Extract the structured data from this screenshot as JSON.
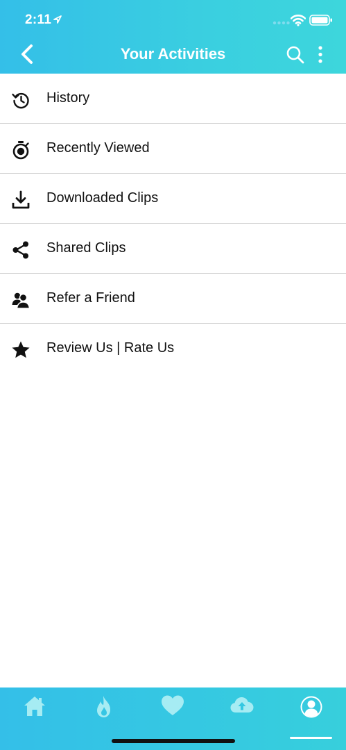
{
  "status_bar": {
    "time": "2:11"
  },
  "navbar": {
    "title": "Your Activities",
    "icons": [
      "back-chevron-icon",
      "search-icon",
      "more-vertical-icon"
    ]
  },
  "menu": {
    "items": [
      {
        "label": "History",
        "icon": "history-icon"
      },
      {
        "label": "Recently Viewed",
        "icon": "stopwatch-icon"
      },
      {
        "label": "Downloaded Clips",
        "icon": "download-icon"
      },
      {
        "label": "Shared Clips",
        "icon": "share-icon"
      },
      {
        "label": "Refer a Friend",
        "icon": "refer-friend-icon"
      },
      {
        "label": "Review Us | Rate Us",
        "icon": "star-icon"
      }
    ]
  },
  "tabbar": {
    "tabs": [
      {
        "icon": "home-icon",
        "active": false
      },
      {
        "icon": "flame-icon",
        "active": false
      },
      {
        "icon": "heart-icon",
        "active": false
      },
      {
        "icon": "cloud-upload-icon",
        "active": false
      },
      {
        "icon": "profile-icon",
        "active": true
      }
    ]
  },
  "colors": {
    "header_gradient_start": "#34bfe8",
    "header_gradient_end": "#3dd6dc",
    "inactive_tab_icon": "#a6ecf3",
    "active_tab_icon": "#ffffff",
    "divider": "#c8c8c8"
  }
}
